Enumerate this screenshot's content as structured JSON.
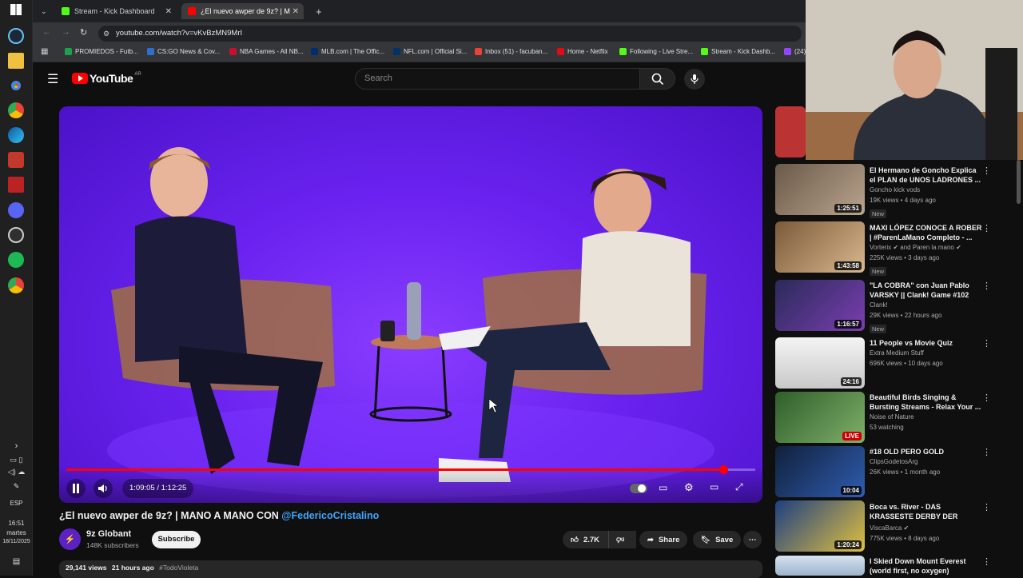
{
  "browser": {
    "tabs": [
      {
        "label": "Stream - Kick Dashboard",
        "color": "#53fc18"
      },
      {
        "label": "¿El nuevo awper de 9z? | M",
        "color": "#ff0000"
      }
    ],
    "url": "youtube.com/watch?v=vKvBzMN9MrI",
    "bookmarks": [
      {
        "label": "PROMIEDOS - Futb...",
        "color": "#1aa34a"
      },
      {
        "label": "CS:GO News & Cov...",
        "color": "#2d6fd1"
      },
      {
        "label": "NBA Games - All NB...",
        "color": "#c8102e"
      },
      {
        "label": "MLB.com | The Offic...",
        "color": "#002d72"
      },
      {
        "label": "NFL.com | Official Si...",
        "color": "#013369"
      },
      {
        "label": "Inbox (51) - facuban...",
        "color": "#ea4335"
      },
      {
        "label": "Home - Netflix",
        "color": "#e50914"
      },
      {
        "label": "Following - Live Stre...",
        "color": "#53fc18"
      },
      {
        "label": "Stream - Kick Dashb...",
        "color": "#53fc18"
      },
      {
        "label": "(24)",
        "color": "#9146ff"
      }
    ]
  },
  "youtube": {
    "logo_text": "YouTube",
    "region": "AR",
    "search_placeholder": "Search"
  },
  "player": {
    "current_time": "1:09:05",
    "duration": "1:12:25",
    "time_display": "1:09:05 / 1:12:25",
    "progress_fraction": 0.954
  },
  "video": {
    "title_main": "¿El nuevo awper de 9z? | MANO A MANO CON ",
    "title_mention": "@FedericoCristalino",
    "channel": "9z Globant",
    "subscribers": "148K subscribers",
    "subscribe_label": "Subscribe",
    "likes": "2.7K",
    "share_label": "Share",
    "save_label": "Save",
    "views": "29,141 views",
    "age": "21 hours ago",
    "hashtag": "#TodoVioleta"
  },
  "taskbar": {
    "time": "16:51",
    "day": "martes",
    "date": "18/11/2025",
    "lang": "ESP"
  },
  "recommendations": [
    {
      "title": "El Hermano de Goncho Explica el PLAN de UNOS LADRONES ...",
      "channel": "Goncho kick vods",
      "meta": "19K views • 4 days ago",
      "duration": "1:25:51",
      "badge": "New"
    },
    {
      "title": "MAXI LÓPEZ CONOCE A ROBER | #ParenLaMano Completo - ...",
      "channel": "Vorterix ✔ and Paren la mano ✔",
      "meta": "225K views • 3 days ago",
      "duration": "1:43:58",
      "badge": "New"
    },
    {
      "title": "\"LA COBRA\" con Juan Pablo VARSKY || Clank! Game #102",
      "channel": "Clank!",
      "meta": "29K views • 22 hours ago",
      "duration": "1:16:57",
      "badge": "New"
    },
    {
      "title": "11 People vs Movie Quiz",
      "channel": "Extra Medium Stuff",
      "meta": "696K views • 10 days ago",
      "duration": "24:16",
      "badge": ""
    },
    {
      "title": "Beautiful Birds Singing & Bursting Streams - Relax Your ...",
      "channel": "Noise of Nature",
      "meta": "53 watching",
      "duration": "LIVE",
      "badge": ""
    },
    {
      "title": "#18 OLD PERO GOLD",
      "channel": "ClipsGodetosArg",
      "meta": "26K views • 1 month ago",
      "duration": "10:04",
      "badge": ""
    },
    {
      "title": "Boca vs. River - DAS KRASSESTE DERBY DER WELT...",
      "channel": "ViscaBarca ✔",
      "meta": "775K views • 8 days ago",
      "duration": "1:20:24",
      "badge": ""
    },
    {
      "title": "I Skied Down Mount Everest (world first, no oxygen)",
      "channel": "",
      "meta": "",
      "duration": "",
      "badge": ""
    }
  ]
}
